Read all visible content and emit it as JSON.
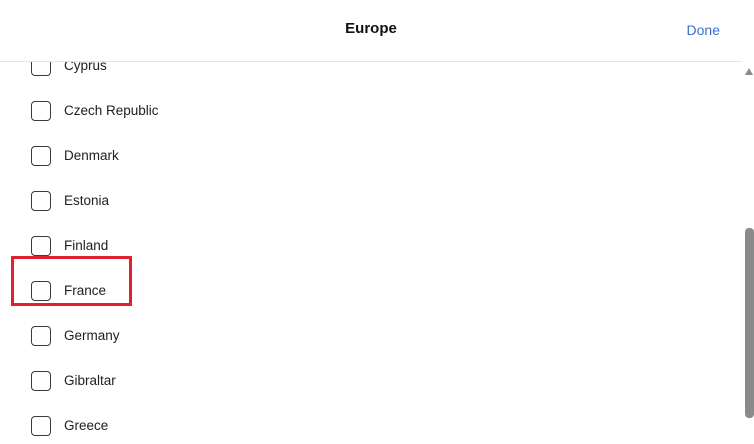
{
  "header": {
    "title": "Europe",
    "done_label": "Done"
  },
  "countries": [
    {
      "label": "Cyprus",
      "checked": false
    },
    {
      "label": "Czech Republic",
      "checked": false
    },
    {
      "label": "Denmark",
      "checked": false
    },
    {
      "label": "Estonia",
      "checked": false
    },
    {
      "label": "Finland",
      "checked": false
    },
    {
      "label": "France",
      "checked": false
    },
    {
      "label": "Germany",
      "checked": false
    },
    {
      "label": "Gibraltar",
      "checked": false
    },
    {
      "label": "Greece",
      "checked": false
    }
  ],
  "colors": {
    "accent": "#3b6fcf",
    "highlight": "#e0212e"
  }
}
